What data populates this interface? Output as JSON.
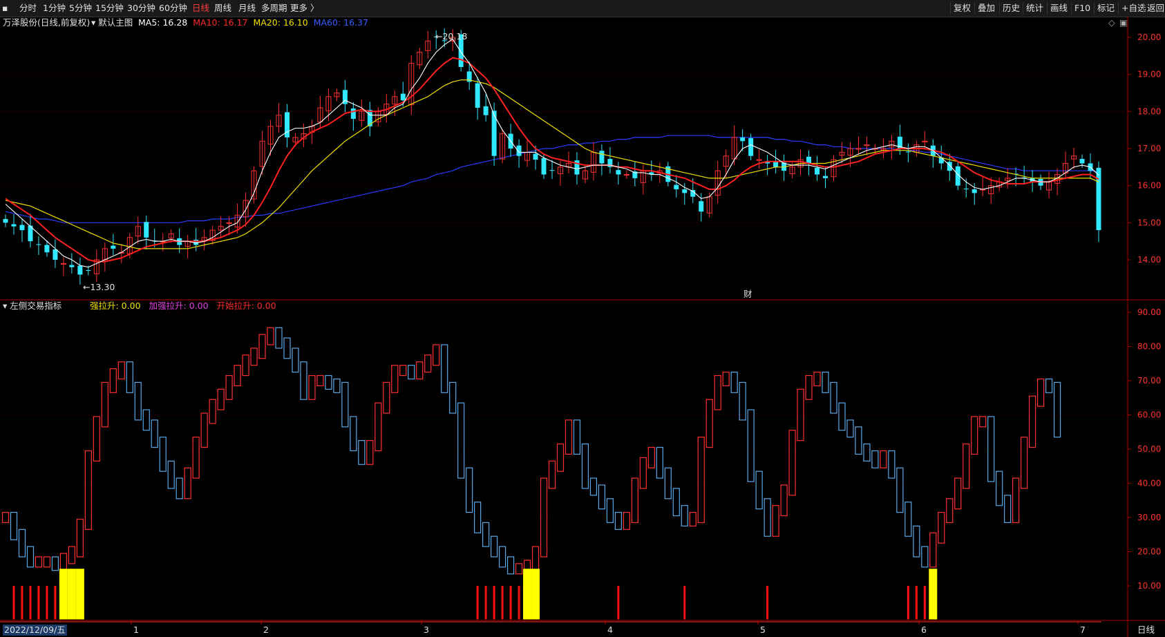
{
  "toolbar": {
    "periods": [
      "分时",
      "1分钟",
      "5分钟",
      "15分钟",
      "30分钟",
      "60分钟",
      "日线",
      "周线",
      "月线",
      "多周期",
      "更多 〉"
    ],
    "active_period": "日线",
    "right_buttons": [
      "复权",
      "叠加",
      "历史",
      "统计",
      "画线",
      "F10",
      "标记",
      "+自选",
      "返回"
    ]
  },
  "main_panel": {
    "title": "万泽股份(日线,前复权)",
    "template": "默认主图",
    "ma": [
      {
        "label": "MA5: 16.28",
        "color": "#ffffff"
      },
      {
        "label": "MA10: 16.17",
        "color": "#ff2a2a"
      },
      {
        "label": "MA20: 16.10",
        "color": "#f0e000"
      },
      {
        "label": "MA60: 16.37",
        "color": "#3a5cff"
      }
    ],
    "high_label": "20.18",
    "low_label": "13.30",
    "event_marker": "财"
  },
  "indicator_panel": {
    "title": "左侧交易指标",
    "values": [
      {
        "label": "强拉升: 0.00",
        "color": "#f0e000"
      },
      {
        "label": "加强拉升: 0.00",
        "color": "#e040e0"
      },
      {
        "label": "开始拉升: 0.00",
        "color": "#ff2a2a"
      }
    ]
  },
  "axis": {
    "price_ticks": [
      "20.00",
      "19.00",
      "18.00",
      "17.00",
      "16.00",
      "15.00",
      "14.00"
    ],
    "indicator_ticks": [
      "90.00",
      "80.00",
      "70.00",
      "60.00",
      "50.00",
      "40.00",
      "30.00",
      "20.00",
      "10.00"
    ],
    "date_start": "2022/12/09/五",
    "month_ticks": [
      "1",
      "2",
      "3",
      "4",
      "5",
      "6",
      "7"
    ],
    "period_label": "日线"
  },
  "colors": {
    "up": "#ff3030",
    "down": "#30e8ff",
    "ma5": "#ffffff",
    "ma10": "#ff2020",
    "ma20": "#f0e000",
    "ma60": "#2a3cff",
    "grid": "#8b0000",
    "ind_down": "#5aa8e8"
  },
  "chart_data": {
    "type": "candlestick",
    "price_close": [
      15.0,
      14.9,
      14.8,
      14.5,
      14.4,
      14.2,
      14.0,
      13.9,
      13.8,
      13.6,
      13.7,
      14.0,
      14.3,
      14.3,
      14.2,
      14.6,
      14.9,
      14.6,
      14.5,
      14.5,
      14.7,
      14.4,
      14.5,
      14.4,
      14.6,
      14.8,
      14.9,
      15.0,
      15.2,
      15.6,
      16.4,
      17.2,
      17.6,
      17.9,
      17.3,
      17.3,
      17.4,
      17.6,
      18.1,
      18.4,
      18.5,
      18.2,
      17.8,
      18.0,
      17.6,
      18.0,
      18.2,
      18.4,
      18.3,
      19.3,
      19.6,
      19.9,
      20.0,
      19.9,
      20.0,
      19.2,
      18.8,
      18.1,
      17.9,
      16.8,
      17.4,
      17.0,
      16.8,
      16.9,
      16.7,
      16.3,
      16.4,
      16.5,
      16.6,
      16.3,
      16.4,
      16.9,
      16.6,
      16.5,
      16.3,
      16.3,
      16.2,
      16.4,
      16.3,
      16.4,
      16.1,
      15.9,
      15.8,
      15.7,
      15.3,
      15.7,
      16.4,
      16.8,
      17.3,
      17.2,
      16.8,
      16.7,
      16.6,
      16.5,
      16.4,
      16.5,
      16.7,
      16.6,
      16.3,
      16.2,
      16.7,
      16.9,
      17.0,
      17.0,
      17.1,
      17.0,
      17.0,
      17.2,
      17.0,
      16.9,
      17.1,
      17.2,
      16.8,
      16.6,
      16.4,
      16.0,
      15.9,
      15.8,
      15.9,
      16.0,
      16.1,
      16.2,
      16.3,
      16.2,
      16.1,
      16.0,
      16.1,
      16.3,
      16.6,
      16.8,
      16.6,
      16.4,
      14.8
    ],
    "ma5": [
      15.5,
      15.3,
      15.1,
      14.9,
      14.7,
      14.5,
      14.3,
      14.1,
      14.0,
      13.85,
      13.8,
      13.9,
      14.0,
      14.1,
      14.2,
      14.35,
      14.5,
      14.55,
      14.5,
      14.5,
      14.55,
      14.5,
      14.5,
      14.45,
      14.5,
      14.6,
      14.75,
      14.9,
      15.0,
      15.35,
      15.8,
      16.4,
      16.9,
      17.3,
      17.45,
      17.55,
      17.55,
      17.6,
      17.7,
      17.9,
      18.1,
      18.3,
      18.2,
      18.1,
      17.9,
      17.9,
      17.9,
      18.1,
      18.2,
      18.6,
      18.9,
      19.3,
      19.6,
      19.8,
      19.95,
      19.6,
      19.3,
      18.9,
      18.5,
      17.9,
      17.5,
      17.2,
      16.9,
      16.9,
      16.9,
      16.75,
      16.65,
      16.55,
      16.5,
      16.45,
      16.5,
      16.55,
      16.55,
      16.55,
      16.5,
      16.45,
      16.35,
      16.35,
      16.3,
      16.3,
      16.2,
      16.1,
      15.95,
      15.85,
      15.65,
      15.7,
      15.95,
      16.3,
      16.7,
      17.0,
      17.1,
      17.0,
      16.9,
      16.75,
      16.6,
      16.55,
      16.55,
      16.55,
      16.5,
      16.45,
      16.55,
      16.65,
      16.75,
      16.85,
      16.95,
      17.0,
      17.05,
      17.1,
      17.05,
      17.0,
      17.05,
      17.05,
      16.95,
      16.75,
      16.55,
      16.3,
      16.1,
      15.95,
      15.9,
      15.95,
      16.0,
      16.1,
      16.2,
      16.2,
      16.15,
      16.1,
      16.1,
      16.2,
      16.35,
      16.5,
      16.55,
      16.5,
      16.28
    ],
    "ma10": [
      15.65,
      15.5,
      15.35,
      15.2,
      15.0,
      14.8,
      14.6,
      14.45,
      14.3,
      14.15,
      14.0,
      13.95,
      13.95,
      14.0,
      14.05,
      14.15,
      14.25,
      14.35,
      14.4,
      14.45,
      14.5,
      14.5,
      14.5,
      14.5,
      14.5,
      14.55,
      14.6,
      14.7,
      14.8,
      14.95,
      15.2,
      15.55,
      15.95,
      16.4,
      16.8,
      17.1,
      17.3,
      17.45,
      17.55,
      17.65,
      17.8,
      17.95,
      18.0,
      18.05,
      18.0,
      18.0,
      18.05,
      18.15,
      18.25,
      18.4,
      18.6,
      18.85,
      19.1,
      19.3,
      19.45,
      19.4,
      19.3,
      19.1,
      18.9,
      18.6,
      18.25,
      17.9,
      17.55,
      17.25,
      17.0,
      16.85,
      16.75,
      16.7,
      16.65,
      16.6,
      16.55,
      16.55,
      16.55,
      16.55,
      16.5,
      16.5,
      16.45,
      16.4,
      16.4,
      16.35,
      16.3,
      16.25,
      16.2,
      16.1,
      16.0,
      15.9,
      15.9,
      16.0,
      16.15,
      16.35,
      16.5,
      16.6,
      16.65,
      16.65,
      16.65,
      16.65,
      16.65,
      16.6,
      16.55,
      16.5,
      16.5,
      16.55,
      16.6,
      16.65,
      16.75,
      16.85,
      16.9,
      16.95,
      17.0,
      17.0,
      17.0,
      17.0,
      16.95,
      16.9,
      16.8,
      16.65,
      16.5,
      16.35,
      16.25,
      16.15,
      16.1,
      16.05,
      16.05,
      16.05,
      16.1,
      16.1,
      16.1,
      16.15,
      16.2,
      16.25,
      16.3,
      16.3,
      16.17
    ],
    "ma20": [
      15.6,
      15.55,
      15.5,
      15.45,
      15.35,
      15.25,
      15.15,
      15.05,
      14.95,
      14.85,
      14.75,
      14.65,
      14.55,
      14.45,
      14.4,
      14.35,
      14.3,
      14.3,
      14.3,
      14.3,
      14.3,
      14.3,
      14.3,
      14.35,
      14.4,
      14.45,
      14.5,
      14.55,
      14.6,
      14.7,
      14.85,
      15.0,
      15.2,
      15.4,
      15.65,
      15.9,
      16.15,
      16.4,
      16.6,
      16.8,
      17.0,
      17.2,
      17.35,
      17.5,
      17.65,
      17.8,
      17.9,
      18.0,
      18.1,
      18.2,
      18.3,
      18.4,
      18.55,
      18.7,
      18.8,
      18.85,
      18.85,
      18.8,
      18.75,
      18.65,
      18.5,
      18.35,
      18.2,
      18.05,
      17.9,
      17.75,
      17.6,
      17.45,
      17.3,
      17.15,
      17.0,
      16.9,
      16.85,
      16.8,
      16.75,
      16.7,
      16.65,
      16.6,
      16.55,
      16.5,
      16.45,
      16.4,
      16.35,
      16.3,
      16.25,
      16.2,
      16.2,
      16.2,
      16.25,
      16.3,
      16.35,
      16.4,
      16.45,
      16.5,
      16.5,
      16.55,
      16.6,
      16.6,
      16.6,
      16.6,
      16.65,
      16.7,
      16.75,
      16.8,
      16.85,
      16.9,
      16.95,
      16.95,
      16.95,
      16.95,
      16.9,
      16.85,
      16.8,
      16.75,
      16.7,
      16.65,
      16.6,
      16.55,
      16.5,
      16.45,
      16.4,
      16.35,
      16.3,
      16.25,
      16.2,
      16.2,
      16.2,
      16.2,
      16.2,
      16.2,
      16.2,
      16.2,
      16.1
    ],
    "ma60": [
      15.3,
      15.25,
      15.2,
      15.15,
      15.1,
      15.1,
      15.05,
      15.0,
      15.0,
      15.0,
      15.0,
      15.0,
      15.0,
      15.0,
      15.0,
      15.0,
      15.0,
      15.0,
      15.0,
      15.0,
      15.0,
      15.0,
      15.05,
      15.05,
      15.05,
      15.1,
      15.1,
      15.1,
      15.15,
      15.15,
      15.2,
      15.2,
      15.25,
      15.25,
      15.3,
      15.35,
      15.4,
      15.45,
      15.5,
      15.55,
      15.6,
      15.65,
      15.7,
      15.75,
      15.8,
      15.85,
      15.9,
      15.95,
      16.0,
      16.1,
      16.15,
      16.2,
      16.3,
      16.35,
      16.4,
      16.5,
      16.55,
      16.6,
      16.65,
      16.7,
      16.75,
      16.8,
      16.85,
      16.9,
      16.95,
      17.0,
      17.0,
      17.05,
      17.1,
      17.1,
      17.15,
      17.15,
      17.2,
      17.2,
      17.25,
      17.25,
      17.3,
      17.3,
      17.3,
      17.3,
      17.35,
      17.35,
      17.35,
      17.35,
      17.35,
      17.35,
      17.3,
      17.3,
      17.3,
      17.3,
      17.3,
      17.3,
      17.3,
      17.25,
      17.25,
      17.2,
      17.2,
      17.15,
      17.1,
      17.1,
      17.05,
      17.05,
      17.0,
      17.0,
      17.0,
      17.0,
      17.0,
      17.0,
      16.95,
      16.95,
      16.95,
      16.9,
      16.9,
      16.85,
      16.8,
      16.75,
      16.7,
      16.65,
      16.6,
      16.55,
      16.5,
      16.45,
      16.45,
      16.4,
      16.4,
      16.4,
      16.4,
      16.4,
      16.4,
      16.4,
      16.4,
      16.4,
      16.37
    ],
    "indicator": [
      30,
      25,
      20,
      17,
      17,
      17,
      16,
      18,
      20,
      28,
      48,
      58,
      68,
      72,
      74,
      68,
      60,
      57,
      52,
      45,
      40,
      37,
      43,
      52,
      59,
      63,
      66,
      70,
      73,
      76,
      78,
      82,
      84,
      81,
      78,
      74,
      66,
      70,
      70,
      69,
      68,
      58,
      51,
      47,
      51,
      62,
      68,
      73,
      73,
      72,
      74,
      76,
      79,
      68,
      62,
      43,
      33,
      27,
      23,
      20,
      17,
      15,
      15,
      16,
      20,
      40,
      45,
      50,
      57,
      50,
      40,
      38,
      34,
      30,
      28,
      30,
      40,
      46,
      49,
      43,
      37,
      32,
      29,
      30,
      52,
      63,
      70,
      71,
      68,
      60,
      42,
      34,
      26,
      32,
      38,
      54,
      66,
      70,
      71,
      68,
      62,
      57,
      55,
      50,
      48,
      46,
      48,
      43,
      33,
      26,
      20,
      17,
      24,
      30,
      34,
      40,
      50,
      58,
      58,
      42,
      35,
      30,
      40,
      52,
      64,
      69,
      68,
      55
    ]
  }
}
